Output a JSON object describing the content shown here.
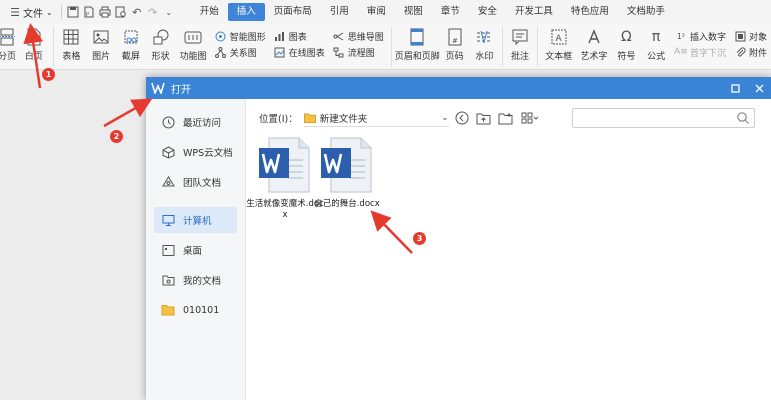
{
  "menubar": {
    "file_menu": "文件",
    "tabs": [
      {
        "label": "开始",
        "active": false
      },
      {
        "label": "插入",
        "active": true
      },
      {
        "label": "页面布局",
        "active": false
      },
      {
        "label": "引用",
        "active": false
      },
      {
        "label": "审阅",
        "active": false
      },
      {
        "label": "视图",
        "active": false
      },
      {
        "label": "章节",
        "active": false
      },
      {
        "label": "安全",
        "active": false
      },
      {
        "label": "开发工具",
        "active": false
      },
      {
        "label": "特色应用",
        "active": false
      },
      {
        "label": "文档助手",
        "active": false
      }
    ]
  },
  "ribbon": {
    "page_break": "分页",
    "blank_page": "白页",
    "table": "表格",
    "picture": "图片",
    "screenshot": "截屏",
    "shape": "形状",
    "function_chart": "功能图",
    "smart_graphic": "智能图形",
    "chart": "图表",
    "mind_map": "思维导图",
    "relation_chart": "关系图",
    "online_chart": "在线图表",
    "flow_chart": "流程图",
    "header_footer": "页眉和页脚",
    "page_number": "页码",
    "watermark": "水印",
    "comment": "批注",
    "text_box": "文本框",
    "word_art": "艺术字",
    "symbol": "符号",
    "formula": "公式",
    "insert_number": "插入数字",
    "object": "对象",
    "first_letter_sink": "首字下沉",
    "attachment": "附件"
  },
  "dialog": {
    "title": "打开",
    "sidebar": [
      {
        "label": "最近访问",
        "icon": "clock-icon",
        "active": false
      },
      {
        "label": "WPS云文档",
        "icon": "cube-icon",
        "active": false
      },
      {
        "label": "团队文档",
        "icon": "team-icon",
        "active": false
      },
      {
        "label": "计算机",
        "icon": "computer-icon",
        "active": true
      },
      {
        "label": "桌面",
        "icon": "desktop-icon",
        "active": false
      },
      {
        "label": "我的文档",
        "icon": "documents-icon",
        "active": false
      },
      {
        "label": "010101",
        "icon": "folder-icon",
        "active": false
      }
    ],
    "location_label": "位置(I)：",
    "location_value": "新建文件夹",
    "files": [
      {
        "name": "生活就像变魔术.docx"
      },
      {
        "name": "自己的舞台.docx"
      }
    ]
  },
  "annotations": [
    "1",
    "2",
    "3"
  ],
  "colors": {
    "accent": "#3a83d6",
    "annotation": "#e53a2e"
  }
}
